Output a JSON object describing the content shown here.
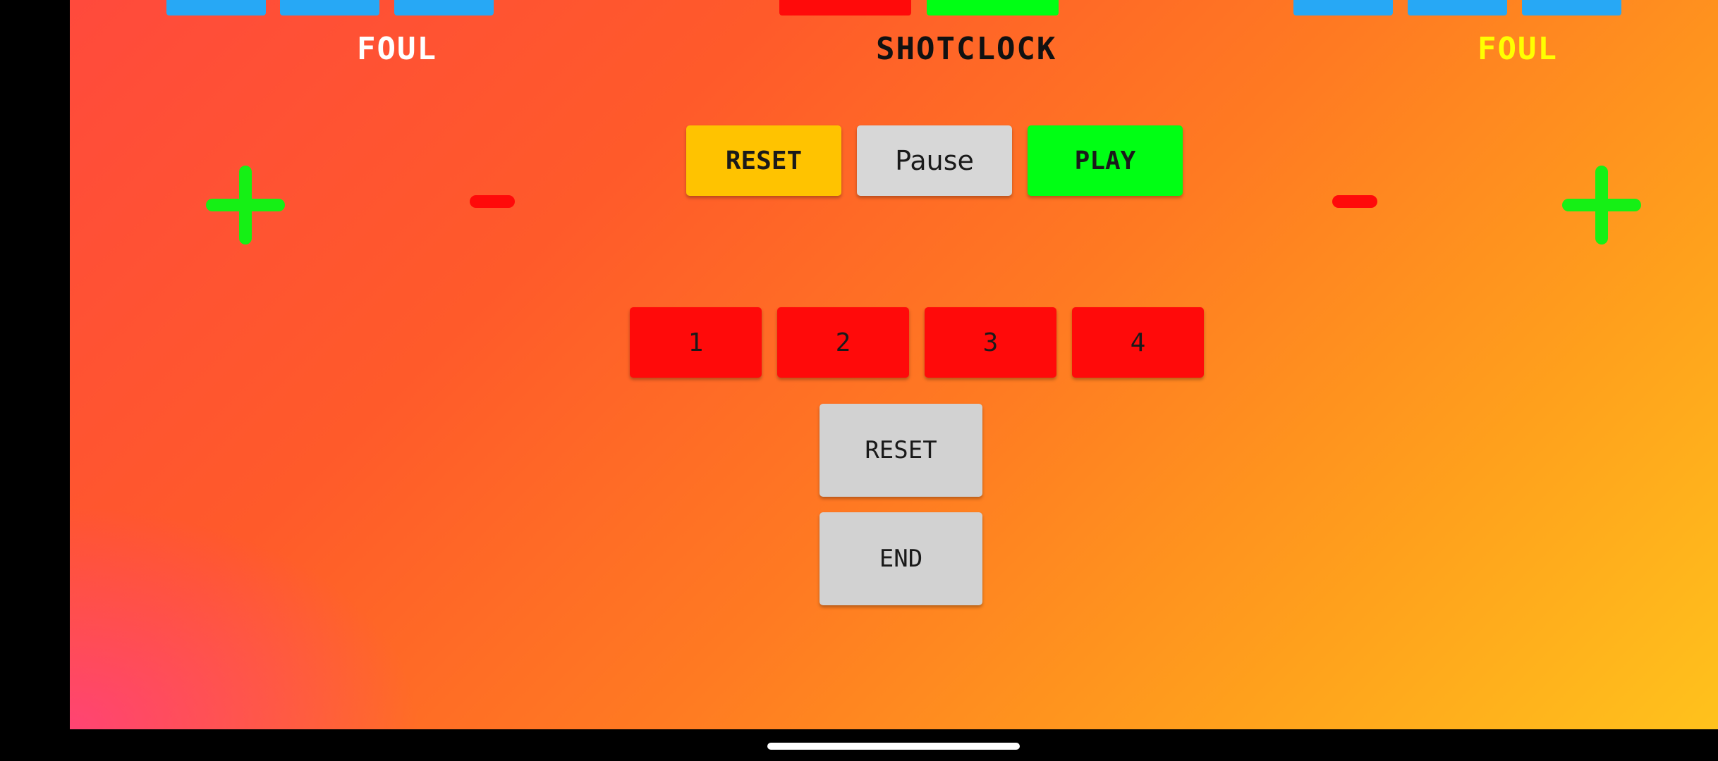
{
  "colors": {
    "blue_tab": "#27a8f5",
    "red": "#ff0a0a",
    "green": "#00ff14",
    "yellow": "#ffc300",
    "gray": "#d2d2d2",
    "home_foul_text": "#ffffff",
    "away_foul_text": "#ffff00",
    "shotclock_text": "#111111"
  },
  "labels": {
    "home_foul": "FOUL",
    "shotclock": "SHOTCLOCK",
    "away_foul": "FOUL"
  },
  "shotclock_controls": {
    "reset": "RESET",
    "pause": "Pause",
    "play": "PLAY"
  },
  "periods": [
    "1",
    "2",
    "3",
    "4"
  ],
  "game_controls": {
    "reset": "RESET",
    "end": "END"
  },
  "icons": {
    "home_foul_plus": "plus-icon",
    "home_foul_minus": "minus-icon",
    "away_foul_minus": "minus-icon",
    "away_foul_plus": "plus-icon"
  }
}
